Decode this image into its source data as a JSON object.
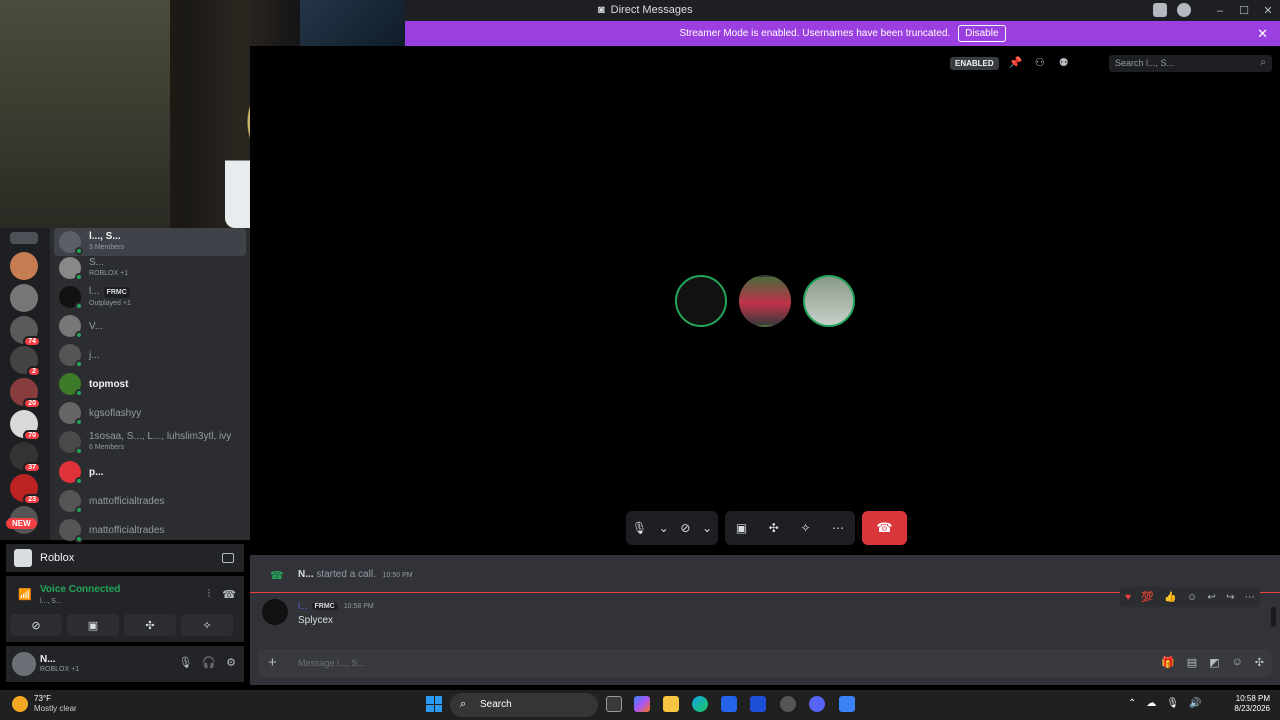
{
  "window": {
    "title": "Direct Messages"
  },
  "streamer": {
    "message": "Streamer Mode is enabled. Usernames have been truncated.",
    "disable_label": "Disable"
  },
  "servers": {
    "badges": [
      "74",
      "2",
      "20",
      "70",
      "37",
      "23"
    ],
    "new_label": "NEW"
  },
  "dms": [
    {
      "name": "l..., S...",
      "sub": "3 Members"
    },
    {
      "name": "S...",
      "sub": "ROBLOX +1"
    },
    {
      "name": "l...",
      "tag": "FRMC",
      "sub": "Outplayed +1"
    },
    {
      "name": "V..."
    },
    {
      "name": "j..."
    },
    {
      "name": "topmost"
    },
    {
      "name": "kgsoflashyy"
    },
    {
      "name": "1sosaa, S..., L..., luhslim3ytl, ivy",
      "sub": "6 Members"
    },
    {
      "name": "p..."
    },
    {
      "name": "mattofficialtrades"
    },
    {
      "name": "mattofficialtrades"
    }
  ],
  "activity": {
    "label": "Roblox"
  },
  "voice": {
    "status": "Voice Connected",
    "channel": "l..., S..."
  },
  "user": {
    "name": "N...",
    "status": "ROBLOX +1"
  },
  "topbar": {
    "enabled_label": "ENABLED",
    "search_placeholder": "Search l..., S..."
  },
  "chat": {
    "system_user": "N...",
    "system_text": "started a call.",
    "system_time": "10:50 PM",
    "msg_author": "l...",
    "msg_tag": "FRMC",
    "msg_time": "10:58 PM",
    "msg_text": "Splycex",
    "input_placeholder": "Message l..., S..."
  },
  "taskbar": {
    "temp": "73°F",
    "weather": "Mostly clear",
    "search_label": "Search",
    "time": "10:58 PM",
    "date": "8/23/2026"
  },
  "colors": {
    "accent": "#5865f2",
    "streamer_bar": "#9b3fe0",
    "online": "#23a55a",
    "danger": "#da373c"
  }
}
